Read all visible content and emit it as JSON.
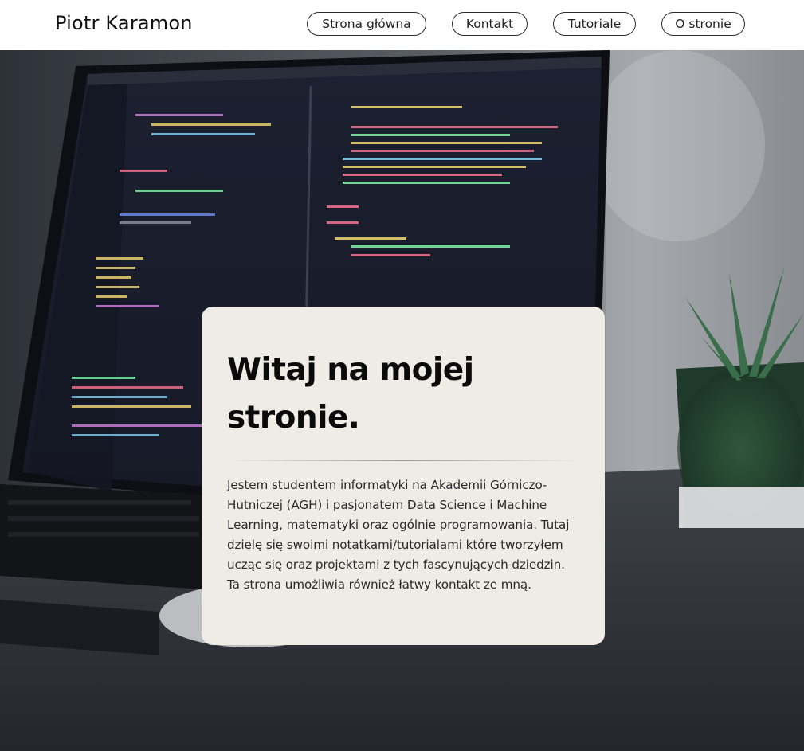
{
  "header": {
    "brand": "Piotr Karamon",
    "nav": [
      {
        "label": "Strona główna"
      },
      {
        "label": "Kontakt"
      },
      {
        "label": "Tutoriale"
      },
      {
        "label": "O stronie"
      }
    ]
  },
  "hero": {
    "title": "Witaj na mojej stronie.",
    "description": "Jestem studentem informatyki na Akademii Górniczo-Hutniczej (AGH) i pasjonatem Data Science i Machine Learning, matematyki oraz ogólnie programowania. Tutaj dzielę się swoimi notatkami/tutorialami które tworzyłem ucząc się oraz projektami z tych fascynujących dziedzin. Ta strona umożliwia również łatwy kontakt ze mną."
  },
  "colors": {
    "header_bg": "#ffffff",
    "card_bg": "#efece6",
    "text": "#111111",
    "code_bg": "#1b1e2b"
  }
}
